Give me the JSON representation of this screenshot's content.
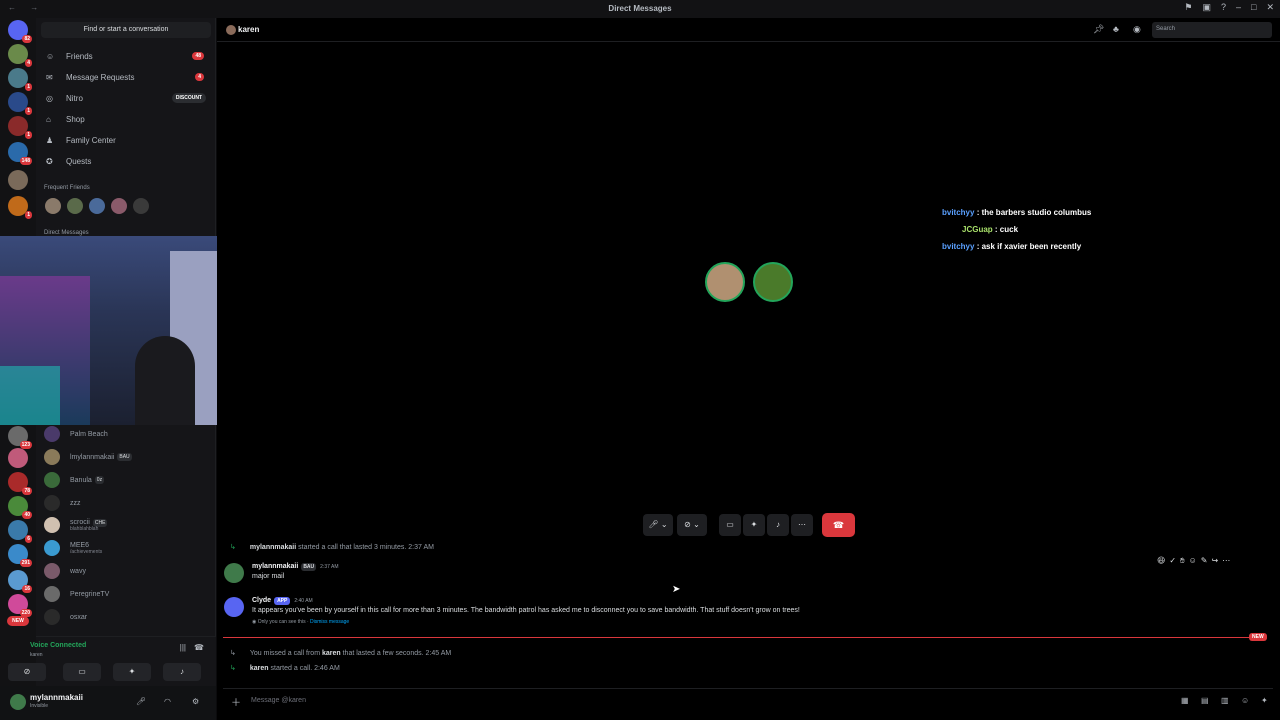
{
  "titlebar": {
    "title": "Direct Messages",
    "nav": "← →"
  },
  "guild_badges": [
    "82",
    "4",
    "1",
    "1",
    "1",
    "148",
    "1",
    "123",
    "78",
    "40",
    "6",
    "291",
    "16",
    "220",
    "NEW"
  ],
  "sidebar": {
    "search_label": "Find or start a conversation",
    "nav": [
      {
        "label": "Friends",
        "badge": "48",
        "icon": "friends-icon"
      },
      {
        "label": "Message Requests",
        "badge": "4",
        "icon": "mail-icon"
      },
      {
        "label": "Nitro",
        "badge": "DISCOUNT",
        "icon": "nitro-icon"
      },
      {
        "label": "Shop",
        "icon": "shop-icon"
      },
      {
        "label": "Family Center",
        "icon": "family-icon"
      },
      {
        "label": "Quests",
        "icon": "quests-icon"
      }
    ],
    "frequent_title": "Frequent Friends",
    "dm_title": "Direct Messages",
    "dms": [
      {
        "name": "Palm Beach",
        "tag": "",
        "sub": ""
      },
      {
        "name": "lmylannmakaii",
        "tag": "BAU",
        "sub": ""
      },
      {
        "name": "Banula",
        "tag": "0z",
        "sub": ""
      },
      {
        "name": "zzz",
        "tag": "",
        "sub": ""
      },
      {
        "name": "scrocii",
        "tag": "CHE",
        "sub": "blahblahblah"
      },
      {
        "name": "MEE6",
        "tag": "",
        "sub": "/achievements"
      },
      {
        "name": "wavy",
        "tag": "",
        "sub": ""
      },
      {
        "name": "PeregrineTV",
        "tag": "",
        "sub": ""
      },
      {
        "name": "osxar",
        "tag": "",
        "sub": ""
      }
    ]
  },
  "voice": {
    "status": "Voice Connected",
    "channel": "karen"
  },
  "user": {
    "name": "mylannmakaii",
    "status": "Invisible"
  },
  "header": {
    "name": "karen",
    "search_placeholder": "Search"
  },
  "chat_overlay": [
    {
      "user": "bvitchyy",
      "text": " : the barbers studio columbus"
    },
    {
      "user": "JCGuap",
      "text": " : cuck"
    },
    {
      "user": "bvitchyy",
      "text": " : ask if xavier been recently"
    }
  ],
  "messages": {
    "sys1": {
      "user": "mylannmakaii",
      "text": " started a call that lasted 3 minutes.",
      "time": "2:37 AM"
    },
    "msg1": {
      "user": "mylannmakaii",
      "tag": "BAU",
      "time": "2:37 AM",
      "text": "major mail"
    },
    "msg2": {
      "user": "Clyde",
      "tag": "APP",
      "time": "2:40 AM",
      "text": "It appears you've been by yourself in this call for more than 3 minutes. The bandwidth patrol has asked me to disconnect you to save bandwidth. That stuff doesn't grow on trees!",
      "note": "Only you can see this · ",
      "dismiss": "Dismiss message"
    },
    "new_label": "NEW",
    "sys2": {
      "pre": "You missed a call from ",
      "user": "karen",
      "post": " that lasted a few seconds.",
      "time": "2:45 AM"
    },
    "sys3": {
      "user": "karen",
      "text": " started a call.",
      "time": "2:46 AM"
    }
  },
  "composer": {
    "placeholder": "Message @karen"
  },
  "colors": {
    "accent": "#5865f2",
    "danger": "#da373c",
    "online": "#23a55a"
  }
}
